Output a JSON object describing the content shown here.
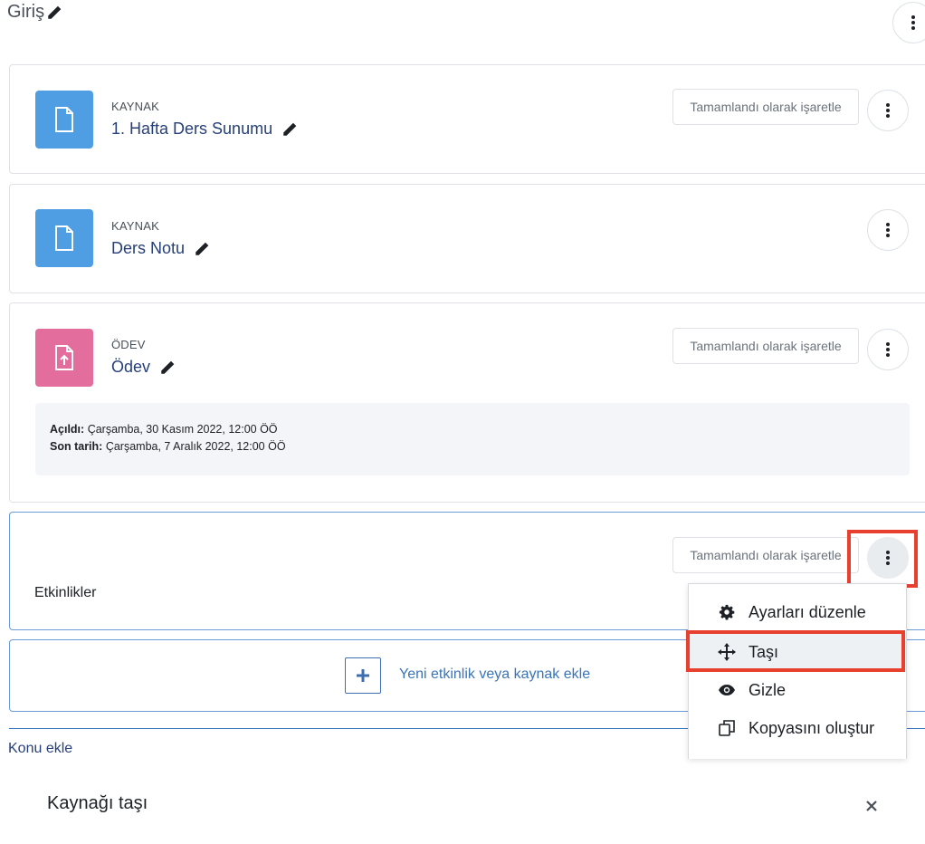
{
  "section": {
    "title": "Giriş"
  },
  "activities": [
    {
      "type": "KAYNAK",
      "name": "1. Hafta Ders Sunumu",
      "complete_label": "Tamamlandı olarak işaretle"
    },
    {
      "type": "KAYNAK",
      "name": "Ders Notu"
    },
    {
      "type": "ÖDEV",
      "name": "Ödev",
      "complete_label": "Tamamlandı olarak işaretle",
      "dates": {
        "opened_label": "Açıldı:",
        "opened_value": "Çarşamba, 30 Kasım 2022, 12:00 ÖÖ",
        "due_label": "Son tarih:",
        "due_value": "Çarşamba, 7 Aralık 2022, 12:00 ÖÖ"
      }
    },
    {
      "name": "Etkinlikler",
      "complete_label": "Tamamlandı olarak işaretle"
    }
  ],
  "menu": {
    "items": [
      {
        "label": "Ayarları düzenle",
        "icon": "gear-icon"
      },
      {
        "label": "Taşı",
        "icon": "move-icon"
      },
      {
        "label": "Gizle",
        "icon": "eye-icon"
      },
      {
        "label": "Kopyasını oluştur",
        "icon": "copy-icon"
      }
    ]
  },
  "add_activity": {
    "label": "Yeni etkinlik veya kaynak ekle"
  },
  "add_topic": {
    "label": "Konu ekle"
  },
  "modal": {
    "title": "Kaynağı taşı"
  },
  "colors": {
    "resource": "#4f9ee3",
    "assign": "#e36d9c",
    "link": "#263f7a",
    "highlight": "#e8402f"
  }
}
